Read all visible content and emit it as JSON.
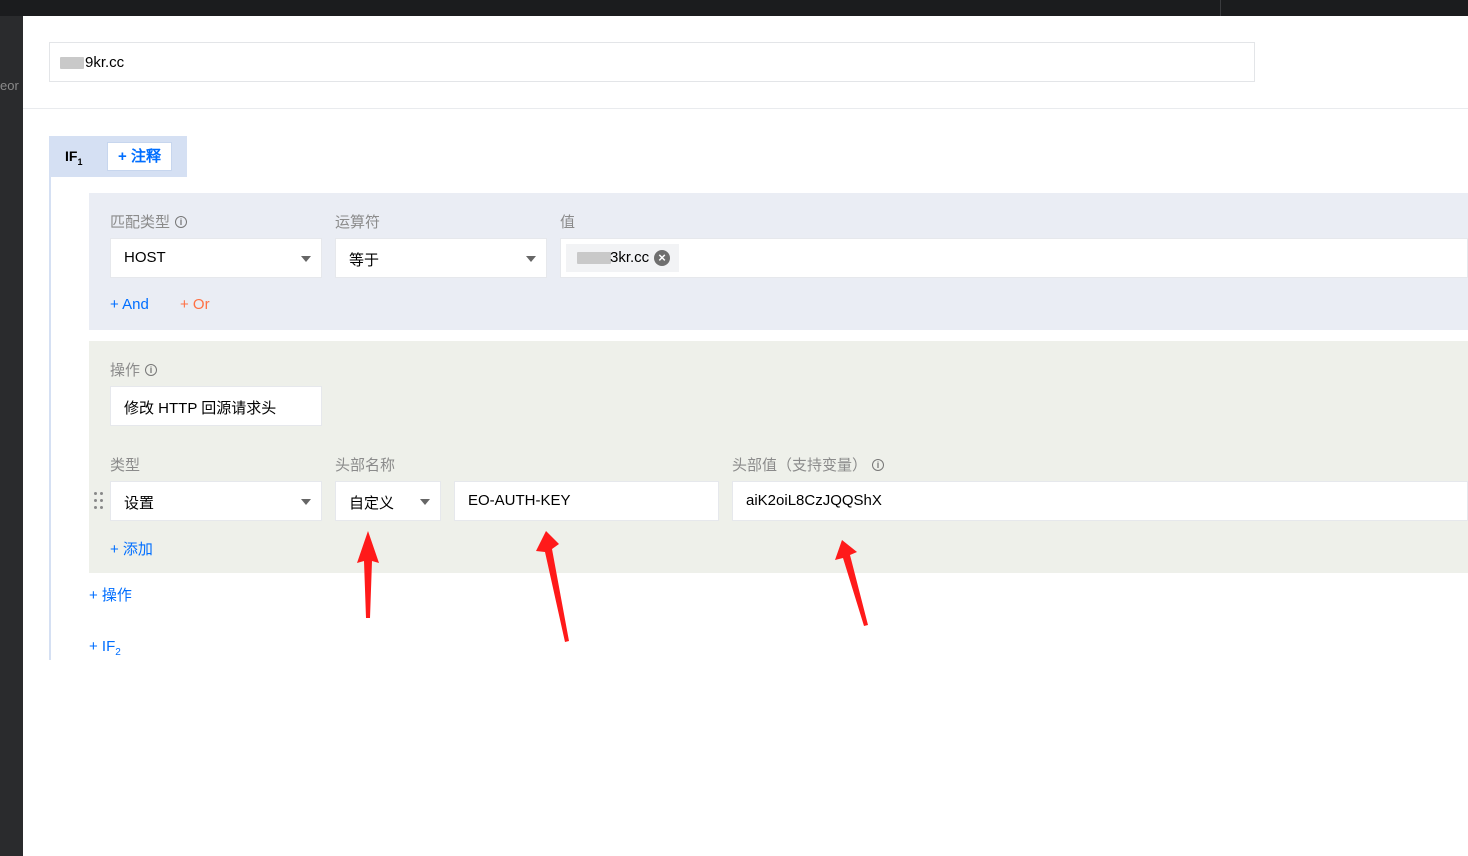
{
  "header": {
    "domain_value": "9kr.cc"
  },
  "sidebar": {
    "peek_text": "eor"
  },
  "rule": {
    "if1_label": "IF",
    "if1_index": "1",
    "note_button": "+ 注释",
    "condition": {
      "match_type_label": "匹配类型",
      "operator_label": "运算符",
      "value_label": "值",
      "match_type_value": "HOST",
      "operator_value": "等于",
      "value_tag": "3kr.cc",
      "and_link": "+ And",
      "or_link": "+ Or"
    },
    "action": {
      "operation_label": "操作",
      "operation_value": "修改 HTTP 回源请求头",
      "type_label": "类型",
      "header_name_label": "头部名称",
      "header_value_label": "头部值（支持变量）",
      "type_value": "设置",
      "header_name_mode": "自定义",
      "header_name_value": "EO-AUTH-KEY",
      "header_value_value": "aiK2oiL8CzJQQShX",
      "add_link": "+ 添加"
    },
    "add_operation_link": "+ 操作",
    "add_if_label": "+ IF",
    "add_if_index": "2"
  },
  "annotations": {
    "arrow_color": "#ff1a1a"
  }
}
